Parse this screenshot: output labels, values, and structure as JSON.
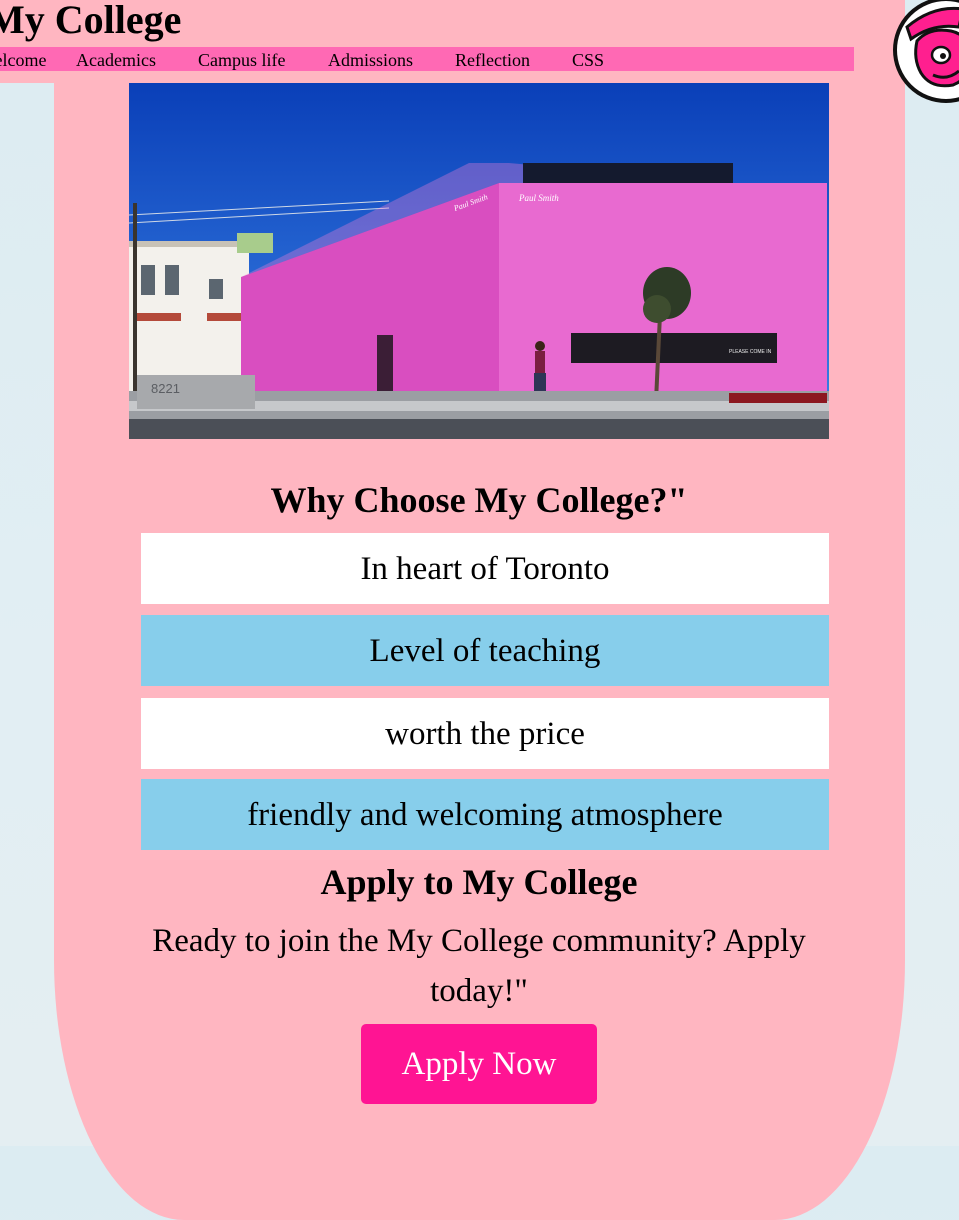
{
  "header": {
    "title": "My College",
    "nav": [
      {
        "label": "Welcome"
      },
      {
        "label": "Academics"
      },
      {
        "label": "Campus life"
      },
      {
        "label": "Admissions"
      },
      {
        "label": "Reflection"
      },
      {
        "label": "CSS"
      }
    ]
  },
  "hero": {
    "building_sign": "Paul Smith",
    "street_number": "8221",
    "window_text": "PLEASE COME IN"
  },
  "why": {
    "heading": "Why Choose My College?\"",
    "reasons": [
      {
        "text": "In heart of Toronto",
        "color": "#ffffff"
      },
      {
        "text": "Level of teaching",
        "color": "#87ceeb"
      },
      {
        "text": "worth the price",
        "color": "#ffffff"
      },
      {
        "text": "friendly and welcoming atmosphere",
        "color": "#87ceeb"
      }
    ]
  },
  "apply": {
    "heading": "Apply to My College",
    "text": "Ready to join the My College community? Apply today!\"",
    "button_label": "Apply Now"
  },
  "colors": {
    "background": "#dfedf2",
    "card": "#ffb6c1",
    "nav": "#ff69b4",
    "button": "#ff1493",
    "reason_alt": "#87ceeb"
  },
  "icons": {
    "logo": "college-mascot-logo-icon"
  }
}
